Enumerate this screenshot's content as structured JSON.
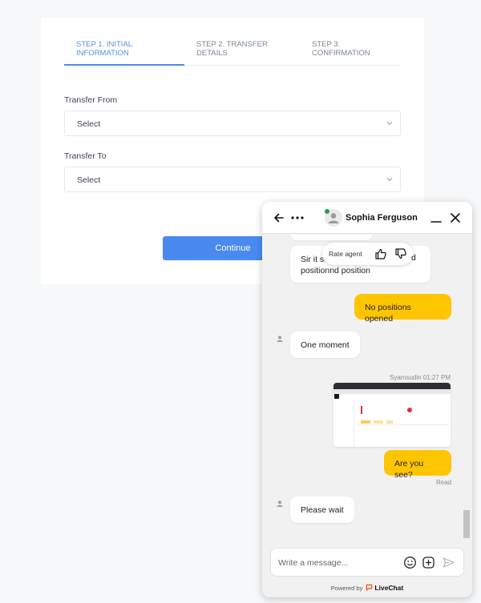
{
  "transfer": {
    "steps": [
      {
        "label": "Step 1. INITIAL\nINFORMATION",
        "active": true
      },
      {
        "label": "Step 2. TRANSFER\nDETAILS",
        "active": false
      },
      {
        "label": "Step 3.\nCONFIRMATION",
        "active": false
      }
    ],
    "from_label": "Transfer From",
    "from_value": "Select",
    "to_label": "Transfer To",
    "to_value": "Select",
    "continue_label": "Continue",
    "accent_color": "#4a8af0"
  },
  "chat": {
    "agent_name": "Sophia Ferguson",
    "agent_status_color": "#2a9d4a",
    "rate_label": "Rate agent",
    "messages": [
      {
        "sender": "agent",
        "text": "Sir it seems you opened positionnd position"
      },
      {
        "sender": "user",
        "text": "No positions opened"
      },
      {
        "sender": "agent",
        "text": "One moment"
      },
      {
        "sender": "user",
        "type": "image",
        "author_time": "Syamsudin 01:27 PM"
      },
      {
        "sender": "user",
        "text": "Are you see?",
        "status": "Read"
      },
      {
        "sender": "agent",
        "text": "Please wait"
      }
    ],
    "partial_text_visible": "d",
    "input_placeholder": "Write a message...",
    "powered_by": "Powered by",
    "brand": "LiveChat",
    "user_bubble_color": "#ffc500"
  }
}
